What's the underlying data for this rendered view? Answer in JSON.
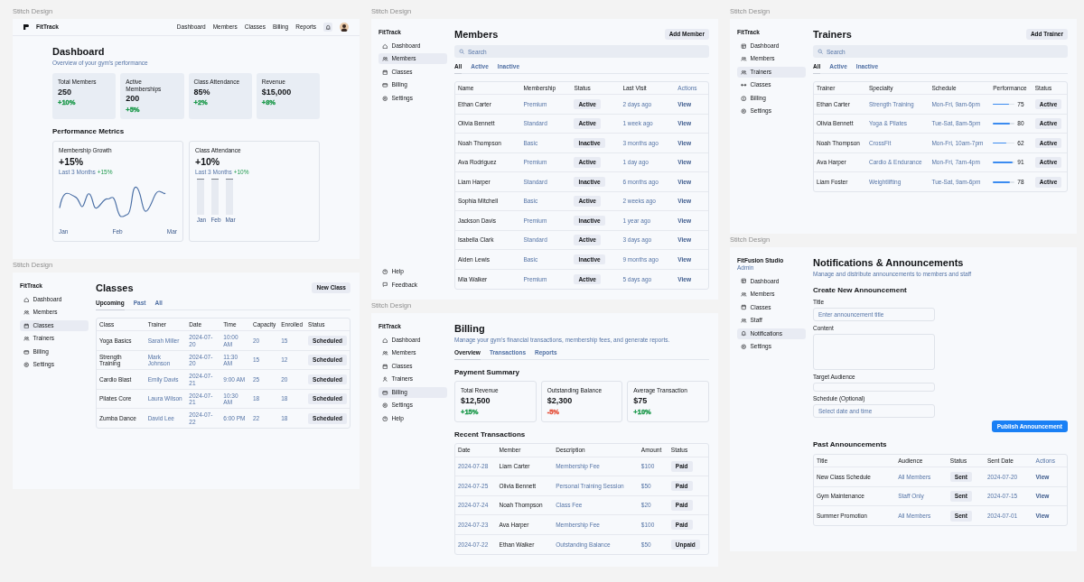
{
  "frames": [
    {
      "caption": "Stitch Design",
      "brand": "FitTrack",
      "nav": [
        "Dashboard",
        "Members",
        "Classes",
        "Billing",
        "Reports"
      ],
      "title": "Dashboard",
      "blocks": [
        {
          "kind": "subtitle",
          "text": "Overview of your gym's performance"
        },
        {
          "kind": "stats",
          "items": [
            {
              "label": "Total Members",
              "value": "250",
              "change": "+10%",
              "color": "#1f9a4d"
            },
            {
              "label": "Active Memberships",
              "value": "200",
              "change": "+5%",
              "color": "#1f9a4d"
            },
            {
              "label": "Class Attendance",
              "value": "85%",
              "change": "+2%",
              "color": "#1f9a4d"
            },
            {
              "label": "Revenue",
              "value": "$15,000",
              "change": "+8%",
              "color": "#1f9a4d"
            }
          ]
        },
        {
          "kind": "heading",
          "text": "Performance Metrics"
        },
        {
          "kind": "metrics",
          "items": [
            {
              "kind": "line",
              "label": "Membership Growth",
              "value": "+15%",
              "period": "Last 3 Months",
              "change": "+15%",
              "x_labels": [
                "Jan",
                "Feb",
                "Mar"
              ]
            },
            {
              "kind": "bars",
              "label": "Class Attendance",
              "value": "+10%",
              "period": "Last 3 Months",
              "change": "+10%",
              "x_labels": [
                "Jan",
                "Feb",
                "Mar"
              ]
            }
          ]
        }
      ]
    },
    {
      "caption": "Stitch Design",
      "brand": "FitTrack",
      "sidebar": [
        {
          "label": "Dashboard",
          "selected": false
        },
        {
          "label": "Members",
          "selected": false
        },
        {
          "label": "Classes",
          "selected": true
        },
        {
          "label": "Trainers",
          "selected": false
        },
        {
          "label": "Billing",
          "selected": false
        },
        {
          "label": "Settings",
          "selected": false
        }
      ],
      "title": "Classes",
      "action": "New Class",
      "blocks": [
        {
          "kind": "tabs",
          "tabs": [
            {
              "label": "Upcoming",
              "selected": true
            },
            {
              "label": "Past",
              "selected": false
            },
            {
              "label": "All",
              "selected": false
            }
          ]
        },
        {
          "kind": "table",
          "columns": [
            {
              "label": "Class",
              "kind": "text"
            },
            {
              "label": "Trainer",
              "kind": "muted"
            },
            {
              "label": "Date",
              "kind": "muted"
            },
            {
              "label": "Time",
              "kind": "muted"
            },
            {
              "label": "Capacity",
              "kind": "muted"
            },
            {
              "label": "Enrolled",
              "kind": "muted"
            },
            {
              "label": "Status",
              "kind": "pill"
            }
          ],
          "rows": [
            {
              "cells": [
                "Yoga Basics",
                "Sarah Miller",
                "2024-07-20",
                "10:00 AM",
                "20",
                "15",
                "Scheduled"
              ]
            },
            {
              "cells": [
                "Strength Training",
                "Mark Johnson",
                "2024-07-20",
                "11:30 AM",
                "15",
                "12",
                "Scheduled"
              ]
            },
            {
              "cells": [
                "Cardio Blast",
                "Emily Davis",
                "2024-07-21",
                "9:00 AM",
                "25",
                "20",
                "Scheduled"
              ]
            },
            {
              "cells": [
                "Pilates Core",
                "Laura Wilson",
                "2024-07-21",
                "10:30 AM",
                "18",
                "18",
                "Scheduled"
              ]
            },
            {
              "cells": [
                "Zumba Dance",
                "David Lee",
                "2024-07-22",
                "6:00 PM",
                "22",
                "18",
                "Scheduled"
              ]
            }
          ]
        }
      ]
    },
    {
      "caption": "Stitch Design",
      "brand": "FitTrack",
      "sidebar": [
        {
          "label": "Dashboard",
          "selected": false
        },
        {
          "label": "Members",
          "selected": true
        },
        {
          "label": "Classes",
          "selected": false
        },
        {
          "label": "Billing",
          "selected": false
        },
        {
          "label": "Settings",
          "selected": false
        }
      ],
      "sidebar_footer": [
        "Help",
        "Feedback"
      ],
      "title": "Members",
      "action": "Add Member",
      "blocks": [
        {
          "kind": "search",
          "placeholder": "Search"
        },
        {
          "kind": "tabs",
          "tabs": [
            {
              "label": "All",
              "selected": true
            },
            {
              "label": "Active",
              "selected": false
            },
            {
              "label": "Inactive",
              "selected": false
            }
          ]
        },
        {
          "kind": "table",
          "columns": [
            {
              "label": "Name",
              "kind": "text"
            },
            {
              "label": "Membership",
              "kind": "muted"
            },
            {
              "label": "Status",
              "kind": "pill"
            },
            {
              "label": "Last Visit",
              "kind": "muted"
            },
            {
              "label": "Actions",
              "kind": "link"
            }
          ],
          "rows": [
            {
              "cells": [
                "Ethan Carter",
                "Premium",
                "Active",
                "2 days ago",
                "View"
              ]
            },
            {
              "cells": [
                "Olivia Bennett",
                "Standard",
                "Active",
                "1 week ago",
                "View"
              ]
            },
            {
              "cells": [
                "Noah Thompson",
                "Basic",
                "Inactive",
                "3 months ago",
                "View"
              ]
            },
            {
              "cells": [
                "Ava Rodriguez",
                "Premium",
                "Active",
                "1 day ago",
                "View"
              ]
            },
            {
              "cells": [
                "Liam Harper",
                "Standard",
                "Inactive",
                "6 months ago",
                "View"
              ]
            },
            {
              "cells": [
                "Sophia Mitchell",
                "Basic",
                "Active",
                "2 weeks ago",
                "View"
              ]
            },
            {
              "cells": [
                "Jackson Davis",
                "Premium",
                "Inactive",
                "1 year ago",
                "View"
              ]
            },
            {
              "cells": [
                "Isabella Clark",
                "Standard",
                "Active",
                "3 days ago",
                "View"
              ]
            },
            {
              "cells": [
                "Aiden Lewis",
                "Basic",
                "Inactive",
                "9 months ago",
                "View"
              ]
            },
            {
              "cells": [
                "Mia Walker",
                "Premium",
                "Active",
                "5 days ago",
                "View"
              ]
            }
          ]
        }
      ]
    },
    {
      "caption": "Stitch Design",
      "brand": "FitTrack",
      "sidebar": [
        {
          "label": "Dashboard",
          "selected": false
        },
        {
          "label": "Members",
          "selected": false
        },
        {
          "label": "Classes",
          "selected": false
        },
        {
          "label": "Trainers",
          "selected": false
        },
        {
          "label": "Billing",
          "selected": true
        },
        {
          "label": "Settings",
          "selected": false
        },
        {
          "label": "Help",
          "selected": false
        }
      ],
      "title": "Billing",
      "blocks": [
        {
          "kind": "subtitle",
          "text": "Manage your gym's financial transactions, membership fees, and generate reports."
        },
        {
          "kind": "tabs",
          "tabs": [
            {
              "label": "Overview",
              "selected": true
            },
            {
              "label": "Transactions",
              "selected": false
            },
            {
              "label": "Reports",
              "selected": false
            }
          ]
        },
        {
          "kind": "heading",
          "text": "Payment Summary"
        },
        {
          "kind": "summary",
          "items": [
            {
              "label": "Total Revenue",
              "value": "$12,500",
              "change": "+15%",
              "color": "#1f9a4d"
            },
            {
              "label": "Outstanding Balance",
              "value": "$2,300",
              "change": "-5%",
              "color": "#e5533d"
            },
            {
              "label": "Average Transaction",
              "value": "$75",
              "change": "+10%",
              "color": "#1f9a4d"
            }
          ]
        },
        {
          "kind": "heading",
          "text": "Recent Transactions"
        },
        {
          "kind": "table",
          "columns": [
            {
              "label": "Date",
              "kind": "muted"
            },
            {
              "label": "Member",
              "kind": "text"
            },
            {
              "label": "Description",
              "kind": "muted"
            },
            {
              "label": "Amount",
              "kind": "muted"
            },
            {
              "label": "Status",
              "kind": "pill"
            }
          ],
          "rows": [
            {
              "cells": [
                "2024-07-28",
                "Liam Carter",
                "Membership Fee",
                "$100",
                "Paid"
              ]
            },
            {
              "cells": [
                "2024-07-25",
                "Olivia Bennett",
                "Personal Training Session",
                "$50",
                "Paid"
              ]
            },
            {
              "cells": [
                "2024-07-24",
                "Noah Thompson",
                "Class Fee",
                "$20",
                "Paid"
              ]
            },
            {
              "cells": [
                "2024-07-23",
                "Ava Harper",
                "Membership Fee",
                "$100",
                "Paid"
              ]
            },
            {
              "cells": [
                "2024-07-22",
                "Ethan Walker",
                "Outstanding Balance",
                "$50",
                "Unpaid"
              ]
            }
          ]
        }
      ]
    },
    {
      "caption": "Stitch Design",
      "brand": "FitTrack",
      "sidebar": [
        {
          "label": "Dashboard",
          "selected": false
        },
        {
          "label": "Members",
          "selected": false
        },
        {
          "label": "Trainers",
          "selected": true
        },
        {
          "label": "Classes",
          "selected": false
        },
        {
          "label": "Billing",
          "selected": false
        },
        {
          "label": "Settings",
          "selected": false
        }
      ],
      "title": "Trainers",
      "action": "Add Trainer",
      "blocks": [
        {
          "kind": "search",
          "placeholder": "Search"
        },
        {
          "kind": "tabs",
          "tabs": [
            {
              "label": "All",
              "selected": true
            },
            {
              "label": "Active",
              "selected": false
            },
            {
              "label": "Inactive",
              "selected": false
            }
          ]
        },
        {
          "kind": "table",
          "columns": [
            {
              "label": "Trainer",
              "kind": "text"
            },
            {
              "label": "Specialty",
              "kind": "muted"
            },
            {
              "label": "Schedule",
              "kind": "muted"
            },
            {
              "label": "Performance",
              "kind": "meter"
            },
            {
              "label": "Status",
              "kind": "pill"
            }
          ],
          "rows": [
            {
              "cells": [
                "Ethan Carter",
                "Strength Training",
                "Mon-Fri, 9am-6pm",
                "75",
                "Active"
              ],
              "level": 0.75
            },
            {
              "cells": [
                "Olivia Bennett",
                "Yoga & Pilates",
                "Tue-Sat, 8am-5pm",
                "80",
                "Active"
              ],
              "level": 0.8
            },
            {
              "cells": [
                "Noah Thompson",
                "CrossFit",
                "Mon-Fri, 10am-7pm",
                "62",
                "Active"
              ],
              "level": 0.62
            },
            {
              "cells": [
                "Ava Harper",
                "Cardio & Endurance",
                "Mon-Fri, 7am-4pm",
                "91",
                "Active"
              ],
              "level": 0.91
            },
            {
              "cells": [
                "Liam Foster",
                "Weightlifting",
                "Tue-Sat, 9am-6pm",
                "78",
                "Active"
              ],
              "level": 0.78
            }
          ]
        }
      ]
    },
    {
      "caption": "Stitch Design",
      "brand": "FitFusion Studio",
      "brand_sub": "Admin",
      "sidebar": [
        {
          "label": "Dashboard",
          "selected": false
        },
        {
          "label": "Members",
          "selected": false
        },
        {
          "label": "Classes",
          "selected": false
        },
        {
          "label": "Staff",
          "selected": false
        },
        {
          "label": "Notifications",
          "selected": true
        },
        {
          "label": "Settings",
          "selected": false
        }
      ],
      "title": "Notifications & Announcements",
      "blocks": [
        {
          "kind": "subtitle",
          "text": "Manage and distribute announcements to members and staff"
        },
        {
          "kind": "heading",
          "text": "Create New Announcement"
        },
        {
          "kind": "input",
          "label": "Title",
          "placeholder": "Enter announcement title"
        },
        {
          "kind": "textarea",
          "label": "Content"
        },
        {
          "kind": "select",
          "label": "Target Audience"
        },
        {
          "kind": "input",
          "label": "Schedule (Optional)",
          "placeholder": "Select date and time"
        },
        {
          "kind": "primary-button",
          "label": "Publish Announcement"
        },
        {
          "kind": "heading",
          "text": "Past Announcements"
        },
        {
          "kind": "table",
          "columns": [
            {
              "label": "Title",
              "kind": "text"
            },
            {
              "label": "Audience",
              "kind": "muted"
            },
            {
              "label": "Status",
              "kind": "pill"
            },
            {
              "label": "Sent Date",
              "kind": "muted"
            },
            {
              "label": "Actions",
              "kind": "link"
            }
          ],
          "rows": [
            {
              "cells": [
                "New Class Schedule",
                "All Members",
                "Sent",
                "2024-07-20",
                "View"
              ]
            },
            {
              "cells": [
                "Gym Maintenance",
                "Staff Only",
                "Sent",
                "2024-07-15",
                "View"
              ]
            },
            {
              "cells": [
                "Summer Promotion",
                "All Members",
                "Sent",
                "2024-07-01",
                "View"
              ]
            }
          ]
        }
      ]
    }
  ]
}
